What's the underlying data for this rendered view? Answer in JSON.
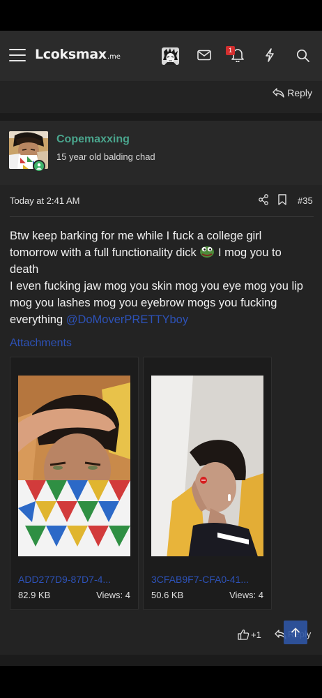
{
  "app": {
    "logo_main": "Lcoksmax",
    "logo_suffix": ".me",
    "notification_count": "1",
    "accent_color": "#4aa58d",
    "link_color": "#2d52b8"
  },
  "nav": {
    "icons": [
      "menu-icon",
      "user-avatar",
      "mail-icon",
      "bell-icon",
      "lightning-icon",
      "search-icon"
    ]
  },
  "top_reply": {
    "label": "Reply"
  },
  "post": {
    "username": "Copemaxxing",
    "user_title": "15 year old balding chad",
    "date": "Today at 2:41 AM",
    "post_number": "#35",
    "body": {
      "line1_before_emoji": "Btw keep barking for me while I fuck a college girl tomorrow with a full functionality dick",
      "line1_after_emoji": " I mog you to death",
      "line2": "I even fucking jaw mog you skin mog you eye mog you lip mog you lashes mog you eyebrow mogs you fucking everything ",
      "mention": "@DoMoverPRETTYboy"
    },
    "attachments_heading": "Attachments",
    "attachments": [
      {
        "name": "ADD277D9-87D7-4...",
        "size": "82.9 KB",
        "views": "Views: 4"
      },
      {
        "name": "3CFAB9F7-CFA0-41...",
        "size": "50.6 KB",
        "views": "Views: 4"
      }
    ],
    "reaction_count": "+1",
    "reply_label": "Reply"
  }
}
